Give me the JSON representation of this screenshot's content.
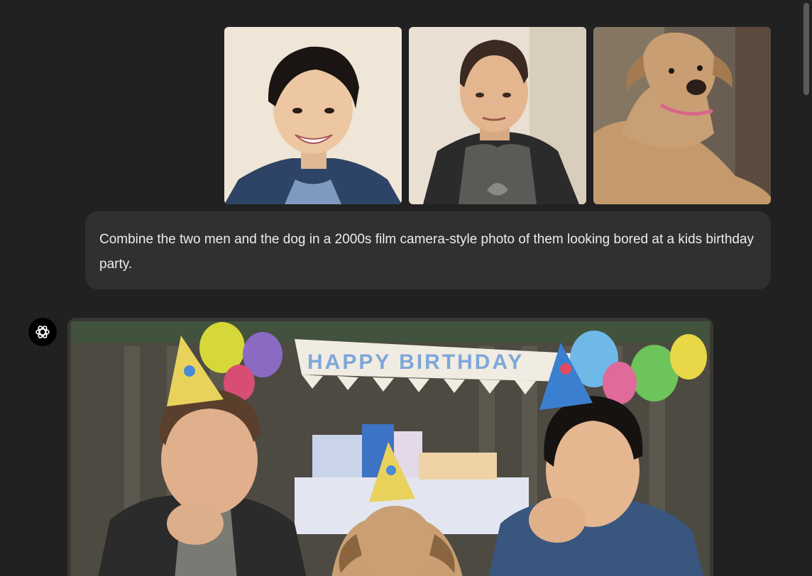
{
  "user_message": {
    "text": "Combine the two men and the dog in a 2000s film camera-style photo of them looking bored at a kids birthday party.",
    "attachments": [
      {
        "name": "man-smiling-photo"
      },
      {
        "name": "man-raglan-shirt-photo"
      },
      {
        "name": "dog-photo"
      }
    ]
  },
  "assistant": {
    "avatar_icon": "openai-logo-icon",
    "image": {
      "banner_text": "HAPPY BIRTHDAY"
    }
  },
  "colors": {
    "background": "#212121",
    "bubble": "#303030",
    "text": "#ececec"
  }
}
